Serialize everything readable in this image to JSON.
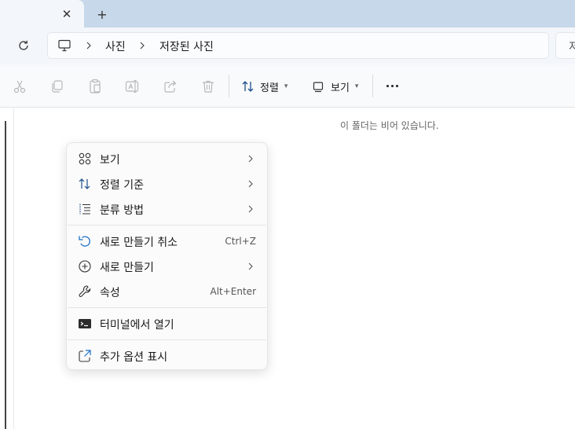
{
  "tabs": {
    "close_symbol": "✕",
    "new_tab_symbol": "+"
  },
  "address": {
    "crumbs": [
      "사진",
      "저장된 사진"
    ],
    "search_placeholder": "저장된 사진 검색"
  },
  "toolbar": {
    "sort_label": "정렬",
    "view_label": "보기",
    "icons": [
      "cut-icon",
      "copy-icon",
      "paste-icon",
      "rename-icon",
      "share-icon",
      "delete-icon",
      "sort-icon",
      "view-icon",
      "more-icon"
    ]
  },
  "content": {
    "empty_message": "이 폴더는 비어 있습니다."
  },
  "context_menu": {
    "items": [
      {
        "label": "보기",
        "submenu": true
      },
      {
        "label": "정렬 기준",
        "submenu": true
      },
      {
        "label": "분류 방법",
        "submenu": true
      },
      {
        "label": "새로 만들기 취소",
        "shortcut": "Ctrl+Z"
      },
      {
        "label": "새로 만들기",
        "submenu": true
      },
      {
        "label": "속성",
        "shortcut": "Alt+Enter"
      },
      {
        "label": "터미널에서 열기"
      },
      {
        "label": "추가 옵션 표시"
      }
    ]
  },
  "colors": {
    "titlebar": "#c7d8ea",
    "accent": "#0067c0",
    "undo_icon": "#1a6fc9"
  }
}
